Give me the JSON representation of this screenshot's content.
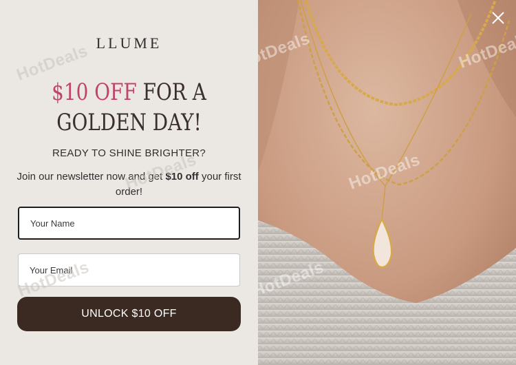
{
  "brand": {
    "logo": "LLUME"
  },
  "headline": {
    "accent": "$10 OFF",
    "rest_line1": " FOR A",
    "line2": "GOLDEN DAY!"
  },
  "subhead": "READY TO SHINE BRIGHTER?",
  "description": {
    "before": "Join our newsletter now and get ",
    "bold": "$10 off",
    "after": " your first order!"
  },
  "form": {
    "name_placeholder": "Your Name",
    "email_placeholder": "Your Email",
    "submit_label": "UNLOCK $10 OFF"
  },
  "watermark": "HotDeals",
  "icons": {
    "close": "close-icon",
    "logo": "hotdeals-logo-icon"
  },
  "colors": {
    "accent": "#c0436a",
    "button": "#3b2a22",
    "background": "#ebe7e3"
  }
}
